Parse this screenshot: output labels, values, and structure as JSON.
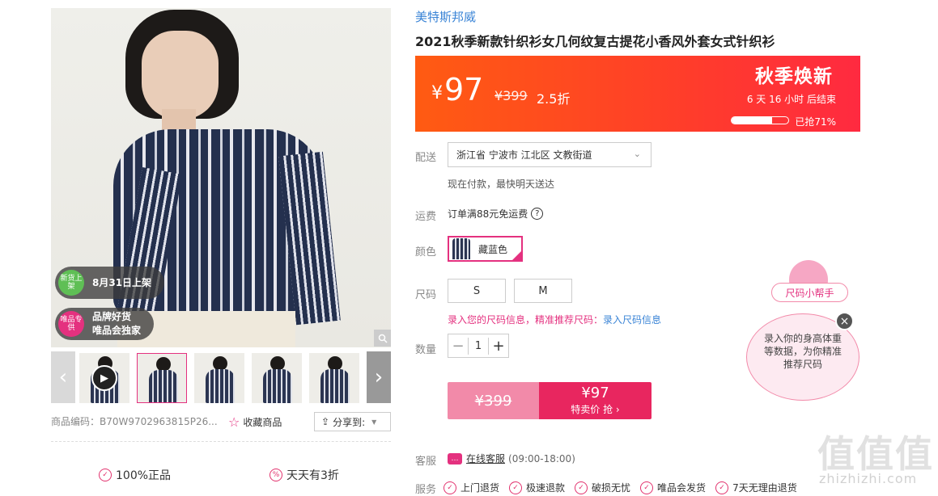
{
  "gallery": {
    "badges": [
      {
        "icon_text": "新货上架",
        "label": "8月31日上架",
        "color": "#5fbf55"
      },
      {
        "icon_text": "唯品专供",
        "label_line1": "品牌好货",
        "label_line2": "唯品会独家",
        "color": "#e4317f"
      }
    ],
    "zoom_icon": "magnifier-icon",
    "product_code": "商品编码：B70W9702963815P26...",
    "favorite": "收藏商品",
    "share": "分享到:",
    "guarantees": [
      "100%正品",
      "天天有3折"
    ]
  },
  "product": {
    "brand": "美特斯邦威",
    "title": "2021秋季新款针织衫女几何纹复古提花小香风外套女式针织衫"
  },
  "price_banner": {
    "currency": "¥",
    "price": "97",
    "original": "¥399",
    "discount": "2.5折",
    "event": "秋季焕新",
    "countdown": "6 天 16 小时 后结束",
    "sold_percent": 71,
    "sold_text": "已抢71%"
  },
  "delivery": {
    "label": "配送",
    "address": "浙江省 宁波市 江北区 文教街道",
    "note": "现在付款，最快明天送达"
  },
  "shipping": {
    "label": "运费",
    "text": "订单满88元免运费"
  },
  "color": {
    "label": "颜色",
    "selected": "藏蓝色"
  },
  "size": {
    "label": "尺码",
    "options": [
      "S",
      "M"
    ],
    "hint": "录入您的尺码信息，精准推荐尺码：",
    "hint_link": "录入尺码信息"
  },
  "quantity": {
    "label": "数量",
    "value": "1",
    "minus": "−",
    "plus": "+"
  },
  "buy": {
    "original": "¥399",
    "price": "¥97",
    "action": "特卖价 抢 ›"
  },
  "customer_service": {
    "label": "客服",
    "link": "在线客服",
    "hours": "(09:00-18:00)"
  },
  "services": {
    "label": "服务",
    "items": [
      "上门退货",
      "极速退款",
      "破损无忧",
      "唯品会发货",
      "7天无理由退货"
    ]
  },
  "size_helper": {
    "tag": "尺码小帮手",
    "bubble": "录入你的身高体重等数据，为你精准推荐尺码"
  },
  "watermark": {
    "glyphs": "值值值",
    "domain": "zhizhizhi.com"
  }
}
